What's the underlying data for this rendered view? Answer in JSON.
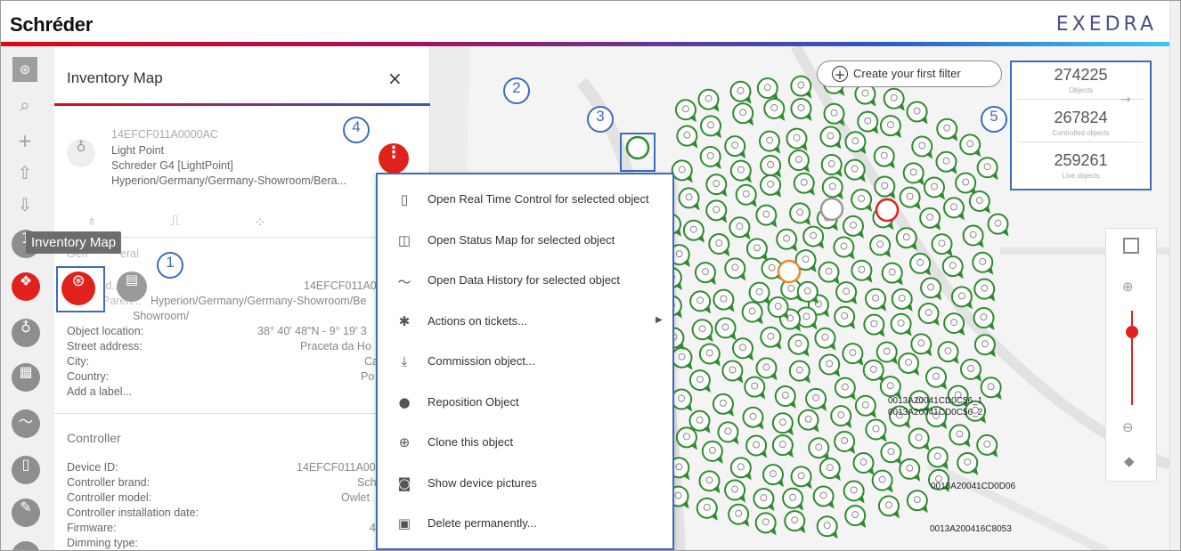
{
  "header": {
    "brand": "Schréder",
    "product": "EXEDRA"
  },
  "colors": {
    "brand_red": "#e1211b",
    "highlight_blue": "#3d6bbf",
    "marker_green": "#2e8b2e"
  },
  "rail": {
    "tooltip": "Inventory Map",
    "icons": [
      "map-icon",
      "search-icon",
      "plus-icon",
      "upload-icon",
      "download-icon",
      "inventory-icon",
      "lightbulb-icon",
      "dashboard-icon",
      "data-history-icon",
      "remote-icon",
      "wrench-icon"
    ]
  },
  "panel": {
    "title": "Inventory Map",
    "close": "×",
    "object_id": "14EFCF011A0000AC",
    "type": "Light Point",
    "model": "Schreder G4 [LightPoint]",
    "path": "Hyperion/Germany/Germany-Showroom/Bera...",
    "general_frag_1": "Gen",
    "general_frag_2": "eral",
    "id_label": "Id...",
    "id_value": "14EFCF011A00",
    "parent_label": "Paren...",
    "parent_value": "Hyperion/Germany/Germany-Showroom/Be",
    "parent_value2": "Showroom/",
    "location_label": "Object location:",
    "location_value": "38° 40' 48\"N - 9° 19' 3",
    "street_label": "Street address:",
    "street_value": "Praceta da Ho",
    "city_label": "City:",
    "city_value": "Ca",
    "country_label": "Country:",
    "country_value": "Po",
    "add_label": "Add a label...",
    "controller_title": "Controller",
    "device_label": "Device ID:",
    "device_value": "14EFCF011A00",
    "brand_label": "Controller brand:",
    "brand_value": "Sch",
    "cmodel_label": "Controller model:",
    "cmodel_value": "Owlet",
    "install_label": "Controller installation date:",
    "firmware_label": "Firmware:",
    "firmware_value": "4",
    "dimming_label": "Dimming type:"
  },
  "menu": {
    "items": [
      {
        "label": "Open Real Time Control for selected object",
        "icon": "remote-icon"
      },
      {
        "label": "Open Status Map for selected object",
        "icon": "status-map-icon"
      },
      {
        "label": "Open Data History for selected object",
        "icon": "data-history-icon"
      },
      {
        "label": "Actions on tickets...",
        "icon": "bug-icon",
        "submenu": true
      },
      {
        "label": "Commission object...",
        "icon": "commission-icon"
      },
      {
        "label": "Reposition Object",
        "icon": "pin-icon"
      },
      {
        "label": "Clone this object",
        "icon": "clone-icon"
      },
      {
        "label": "Show device pictures",
        "icon": "camera-icon"
      },
      {
        "label": "Delete permanently...",
        "icon": "trash-icon"
      }
    ]
  },
  "map": {
    "filter_label": "Create your first filter",
    "stats": [
      {
        "value": "274225",
        "caption": "Objects"
      },
      {
        "value": "267824",
        "caption": "Controlled objects"
      },
      {
        "value": "259261",
        "caption": "Live objects"
      }
    ],
    "labels": [
      "0013A20041CD0D06",
      "0013A200416C8053",
      "0013A20041CD0C56_1",
      "0013A20041CD0C56_2"
    ],
    "zoom_level": 0.88
  },
  "callouts": [
    "1",
    "2",
    "3",
    "4",
    "5"
  ]
}
